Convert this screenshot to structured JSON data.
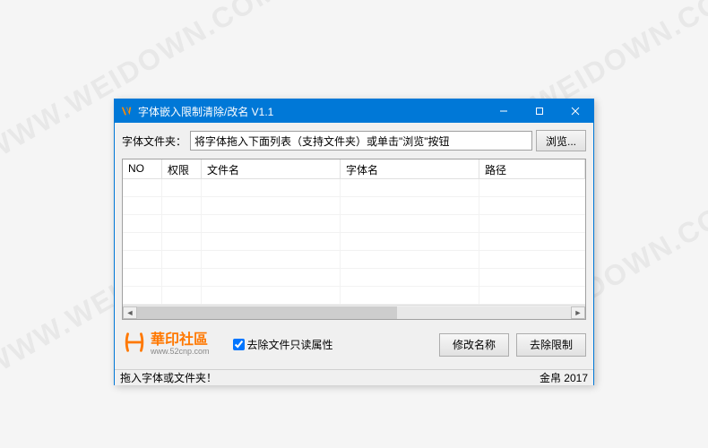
{
  "watermark": "WWW.WEIDOWN.COM",
  "window": {
    "title": "字体嵌入限制清除/改名 V1.1"
  },
  "top": {
    "folder_label": "字体文件夹：",
    "path_value": "将字体拖入下面列表（支持文件夹）或单击\"浏览\"按钮",
    "browse_label": "浏览..."
  },
  "list": {
    "columns": {
      "no": "NO",
      "perm": "权限",
      "file": "文件名",
      "font": "字体名",
      "path": "路径"
    }
  },
  "bottom": {
    "logo_main": "華印社區",
    "logo_sub": "www.52cnp.com",
    "checkbox_label": "去除文件只读属性",
    "rename_label": "修改名称",
    "remove_label": "去除限制"
  },
  "status": {
    "left": "拖入字体或文件夹！",
    "right": "金帛 2017"
  }
}
